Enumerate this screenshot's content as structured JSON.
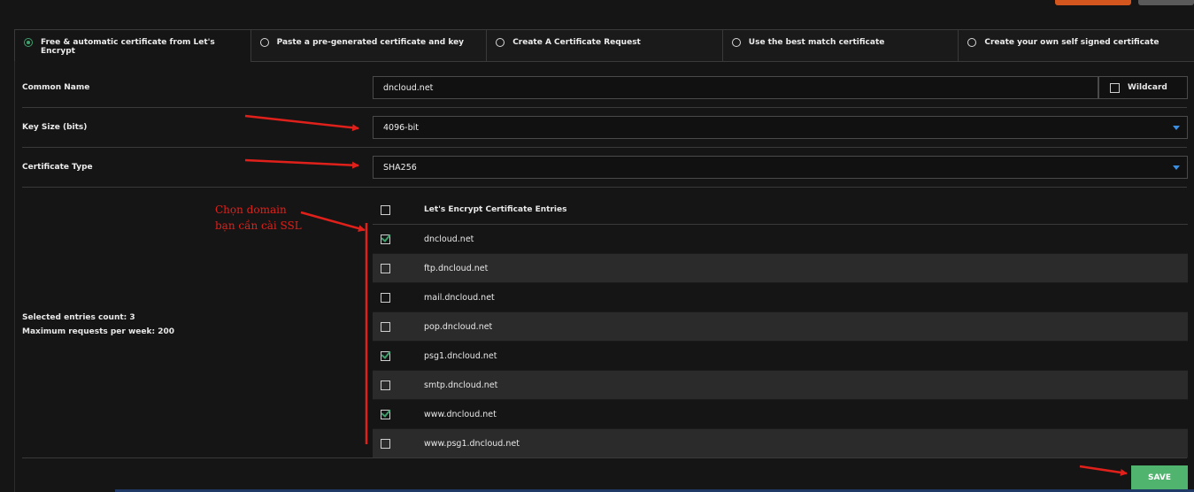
{
  "tabs": [
    {
      "label": "Free & automatic certificate from Let's Encrypt",
      "selected": true
    },
    {
      "label": "Paste a pre-generated certificate and key",
      "selected": false
    },
    {
      "label": "Create A Certificate Request",
      "selected": false
    },
    {
      "label": "Use the best match certificate",
      "selected": false
    },
    {
      "label": "Create your own self signed certificate",
      "selected": false
    }
  ],
  "form": {
    "common_name": {
      "label": "Common Name",
      "value": "dncloud.net"
    },
    "wildcard": {
      "label": "Wildcard",
      "checked": false
    },
    "key_size": {
      "label": "Key Size (bits)",
      "value": "4096-bit"
    },
    "cert_type": {
      "label": "Certificate Type",
      "value": "SHA256"
    }
  },
  "entries": {
    "header": "Let's Encrypt Certificate Entries",
    "items": [
      {
        "domain": "dncloud.net",
        "checked": true
      },
      {
        "domain": "ftp.dncloud.net",
        "checked": false
      },
      {
        "domain": "mail.dncloud.net",
        "checked": false
      },
      {
        "domain": "pop.dncloud.net",
        "checked": false
      },
      {
        "domain": "psg1.dncloud.net",
        "checked": true
      },
      {
        "domain": "smtp.dncloud.net",
        "checked": false
      },
      {
        "domain": "www.dncloud.net",
        "checked": true
      },
      {
        "domain": "www.psg1.dncloud.net",
        "checked": false
      }
    ]
  },
  "stats": {
    "selected": "Selected entries count: 3",
    "max": "Maximum requests per week: 200"
  },
  "save_label": "SAVE",
  "annotation": {
    "line1": "Chọn domain",
    "line2": "bạn cần cài SSL"
  },
  "colors": {
    "accent_green": "#50b36e",
    "annotation_red": "#e0201a",
    "select_arrow": "#3b8fe0"
  }
}
